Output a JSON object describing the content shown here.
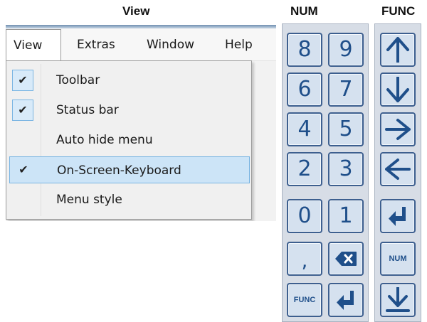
{
  "titles": {
    "view": "View",
    "num": "NUM",
    "func": "FUNC"
  },
  "menubar": {
    "items": [
      "View",
      "Extras",
      "Window",
      "Help"
    ]
  },
  "view_menu": {
    "items": [
      {
        "label": "Toolbar",
        "checked": true,
        "check_glyph": "✔"
      },
      {
        "label": "Status bar",
        "checked": true,
        "check_glyph": "✔"
      },
      {
        "label": "Auto hide menu",
        "checked": false,
        "check_glyph": ""
      },
      {
        "label": "On-Screen-Keyboard",
        "checked": true,
        "highlighted": true,
        "check_glyph": "✔"
      },
      {
        "label": "Menu style",
        "checked": false,
        "check_glyph": ""
      }
    ]
  },
  "num_pad": {
    "keys": [
      "8",
      "9",
      "6",
      "7",
      "4",
      "5",
      "2",
      "3",
      "0",
      "1",
      ",",
      "backspace-icon",
      "FUNC",
      "enter-icon"
    ]
  },
  "func_pad": {
    "keys": [
      "arrow-up-icon",
      "arrow-down-icon",
      "arrow-right-icon",
      "arrow-left-icon",
      "enter-icon",
      "NUM",
      "arrow-down-to-line-icon"
    ]
  },
  "colors": {
    "key_fill": "#d5e1ef",
    "key_border": "#3d5f8f",
    "key_glyph": "#1f4f8a",
    "menu_highlight": "#cce4f7",
    "menu_highlight_border": "#7ab5e3"
  }
}
